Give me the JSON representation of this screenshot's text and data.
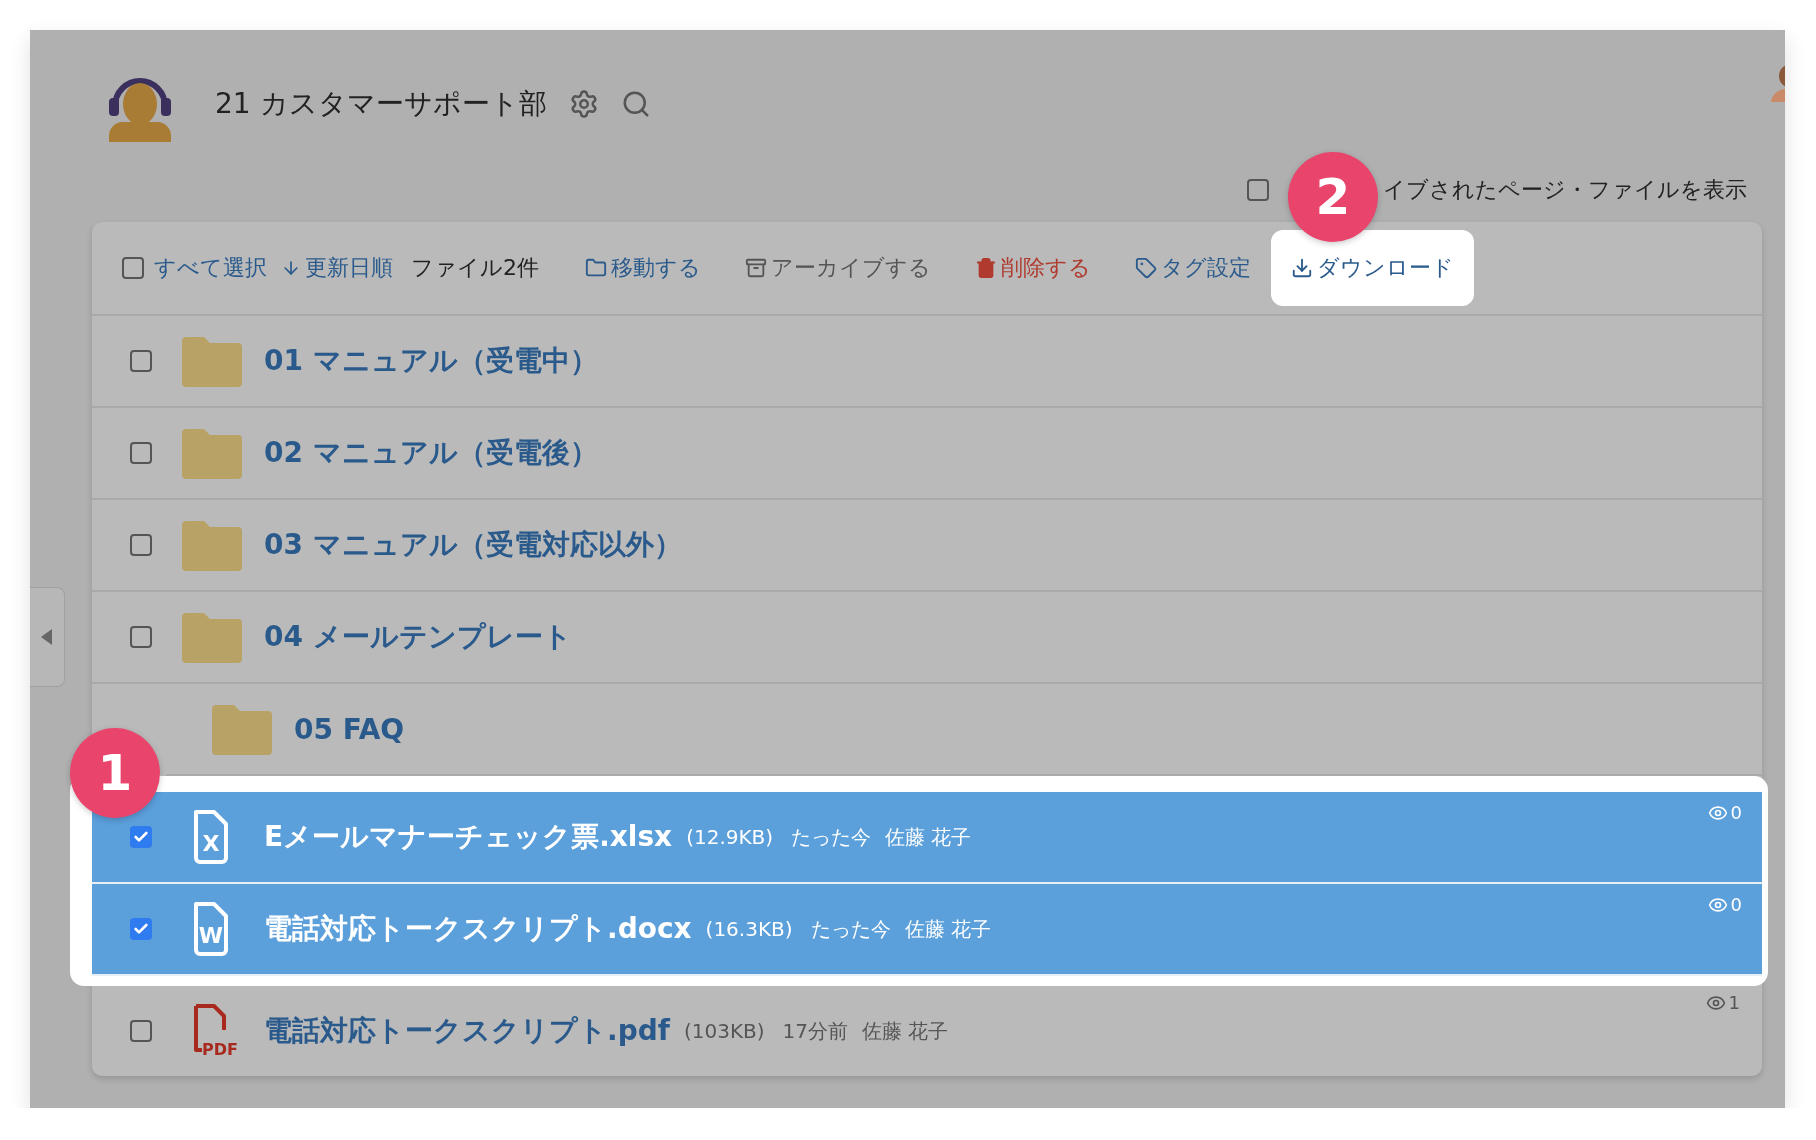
{
  "header": {
    "title": "21 カスタマーサポート部"
  },
  "archive_toggle": {
    "label": "イブされたページ・ファイルを表示",
    "checked": false
  },
  "toolbar": {
    "select_all": {
      "label": "すべて選択",
      "checked": false
    },
    "sort": "更新日順",
    "count": "ファイル2件",
    "actions": [
      {
        "kind": "move",
        "label": "移動する",
        "highlighted": false
      },
      {
        "kind": "archive",
        "label": "アーカイブする",
        "highlighted": false
      },
      {
        "kind": "delete",
        "label": "削除する",
        "highlighted": false
      },
      {
        "kind": "tag",
        "label": "タグ設定",
        "highlighted": false
      },
      {
        "kind": "download",
        "label": "ダウンロード",
        "highlighted": true
      }
    ]
  },
  "items": [
    {
      "kind": "folder",
      "name": "01 マニュアル（受電中）",
      "checked": false
    },
    {
      "kind": "folder",
      "name": "02 マニュアル（受電後）",
      "checked": false
    },
    {
      "kind": "folder",
      "name": "03 マニュアル（受電対応以外）",
      "checked": false
    },
    {
      "kind": "folder",
      "name": "04 メールテンプレート",
      "checked": false
    },
    {
      "kind": "folder",
      "name": "05 FAQ"
    },
    {
      "kind": "xlsx",
      "icon_label": "X",
      "name": "Eメールマナーチェック票.xlsx",
      "size": "(12.9KB)",
      "time": "たった今",
      "author": "佐藤 花子",
      "views": "0",
      "checked": true
    },
    {
      "kind": "docx",
      "icon_label": "W",
      "name": "電話対応トークスクリプト.docx",
      "size": "(16.3KB)",
      "time": "たった今",
      "author": "佐藤 花子",
      "views": "0",
      "checked": true
    },
    {
      "kind": "pdf",
      "icon_label": "PDF",
      "name": "電話対応トークスクリプト.pdf",
      "size": "(103KB)",
      "time": "17分前",
      "author": "佐藤 花子",
      "views": "1",
      "checked": false
    }
  ],
  "callouts": [
    "1",
    "2"
  ]
}
